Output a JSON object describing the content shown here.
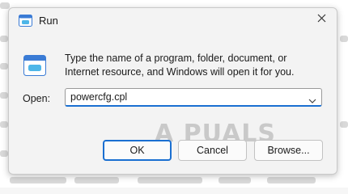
{
  "window": {
    "title": "Run",
    "description": "Type the name of a program, folder, document, or Internet resource, and Windows will open it for you."
  },
  "open_field": {
    "label": "Open:",
    "value": "powercfg.cpl"
  },
  "buttons": {
    "ok": "OK",
    "cancel": "Cancel",
    "browse": "Browse..."
  },
  "watermark": "A PUALS",
  "colors": {
    "accent": "#1a6fd1",
    "dialog_background": "#f3f3f3"
  },
  "icons": {
    "title_icon": "run-icon",
    "close": "close-icon",
    "body_icon": "run-icon-large",
    "dropdown": "chevron-down-icon"
  }
}
